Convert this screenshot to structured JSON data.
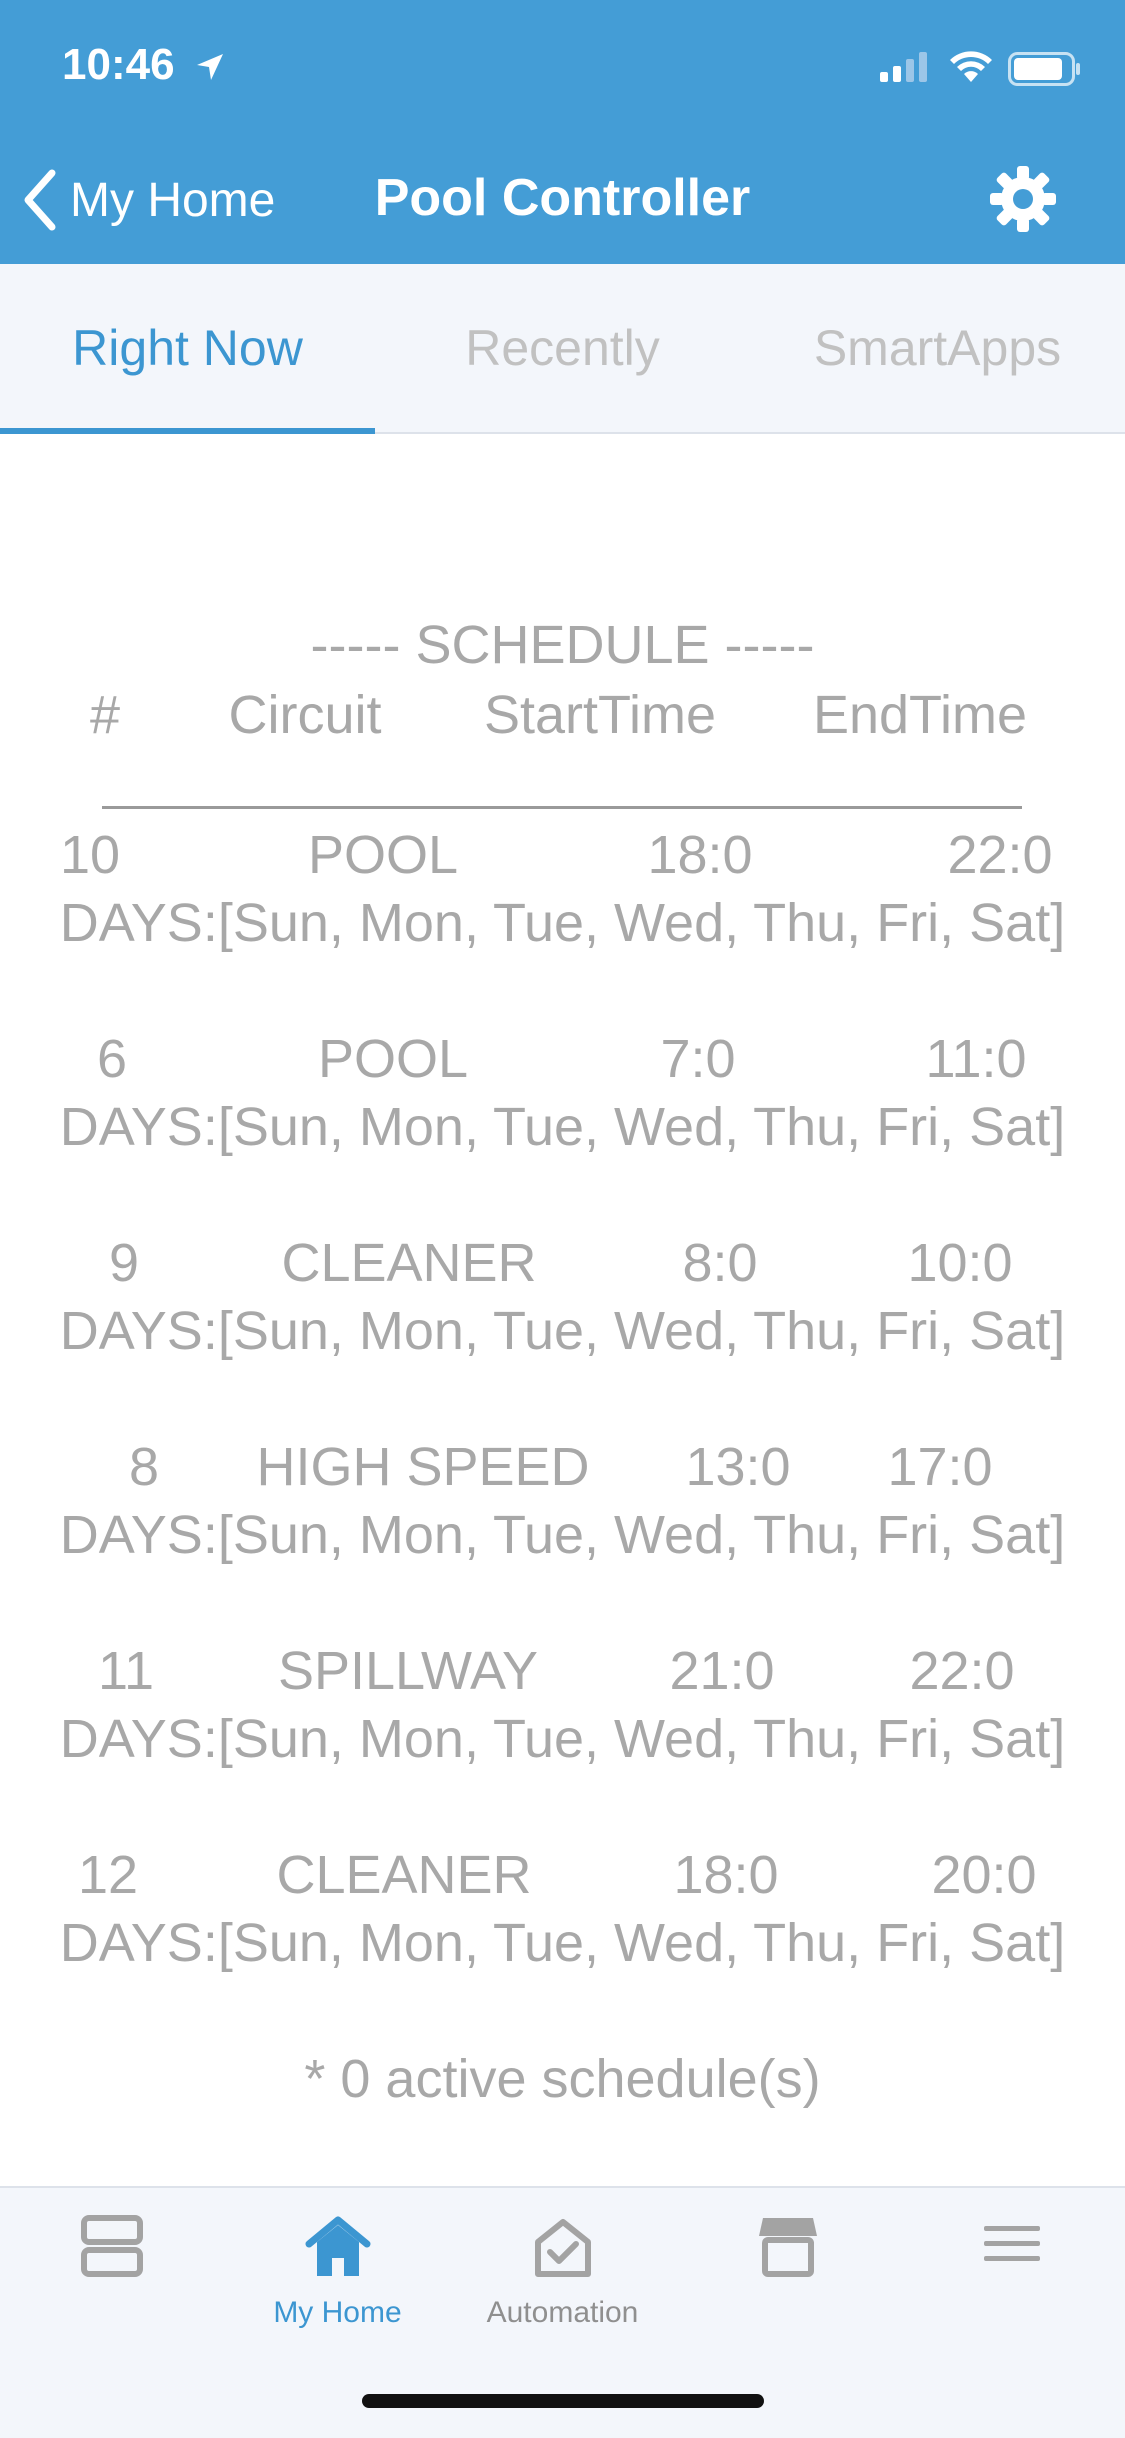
{
  "status_bar": {
    "time": "10:46"
  },
  "header": {
    "back_label": "My Home",
    "title": "Pool Controller"
  },
  "tabs": [
    {
      "label": "Right Now",
      "active": true
    },
    {
      "label": "Recently",
      "active": false
    },
    {
      "label": "SmartApps",
      "active": false
    }
  ],
  "schedule": {
    "title": "----- SCHEDULE -----",
    "columns": [
      "#",
      "Circuit",
      "StartTime",
      "EndTime"
    ],
    "rows": [
      {
        "num": "10",
        "circuit": "POOL",
        "start": "18:0",
        "end": "22:0",
        "days": "DAYS:[Sun, Mon, Tue, Wed, Thu, Fri, Sat]"
      },
      {
        "num": "6",
        "circuit": "POOL",
        "start": "7:0",
        "end": "11:0",
        "days": "DAYS:[Sun, Mon, Tue, Wed, Thu, Fri, Sat]"
      },
      {
        "num": "9",
        "circuit": "CLEANER",
        "start": "8:0",
        "end": "10:0",
        "days": "DAYS:[Sun, Mon, Tue, Wed, Thu, Fri, Sat]"
      },
      {
        "num": "8",
        "circuit": "HIGH SPEED",
        "start": "13:0",
        "end": "17:0",
        "days": "DAYS:[Sun, Mon, Tue, Wed, Thu, Fri, Sat]"
      },
      {
        "num": "11",
        "circuit": "SPILLWAY",
        "start": "21:0",
        "end": "22:0",
        "days": "DAYS:[Sun, Mon, Tue, Wed, Thu, Fri, Sat]"
      },
      {
        "num": "12",
        "circuit": "CLEANER",
        "start": "18:0",
        "end": "20:0",
        "days": "DAYS:[Sun, Mon, Tue, Wed, Thu, Fri, Sat]"
      }
    ],
    "footer": "* 0 active schedule(s)"
  },
  "bottom_nav": [
    {
      "label": "",
      "icon": "dashboard-icon",
      "active": false
    },
    {
      "label": "My Home",
      "icon": "home-icon",
      "active": true
    },
    {
      "label": "Automation",
      "icon": "automation-icon",
      "active": false
    },
    {
      "label": "",
      "icon": "marketplace-icon",
      "active": false
    },
    {
      "label": "",
      "icon": "menu-icon",
      "active": false
    }
  ],
  "colors": {
    "header_bg": "#449dd6",
    "accent": "#3c96d1",
    "text_muted": "#a8a8a8"
  }
}
